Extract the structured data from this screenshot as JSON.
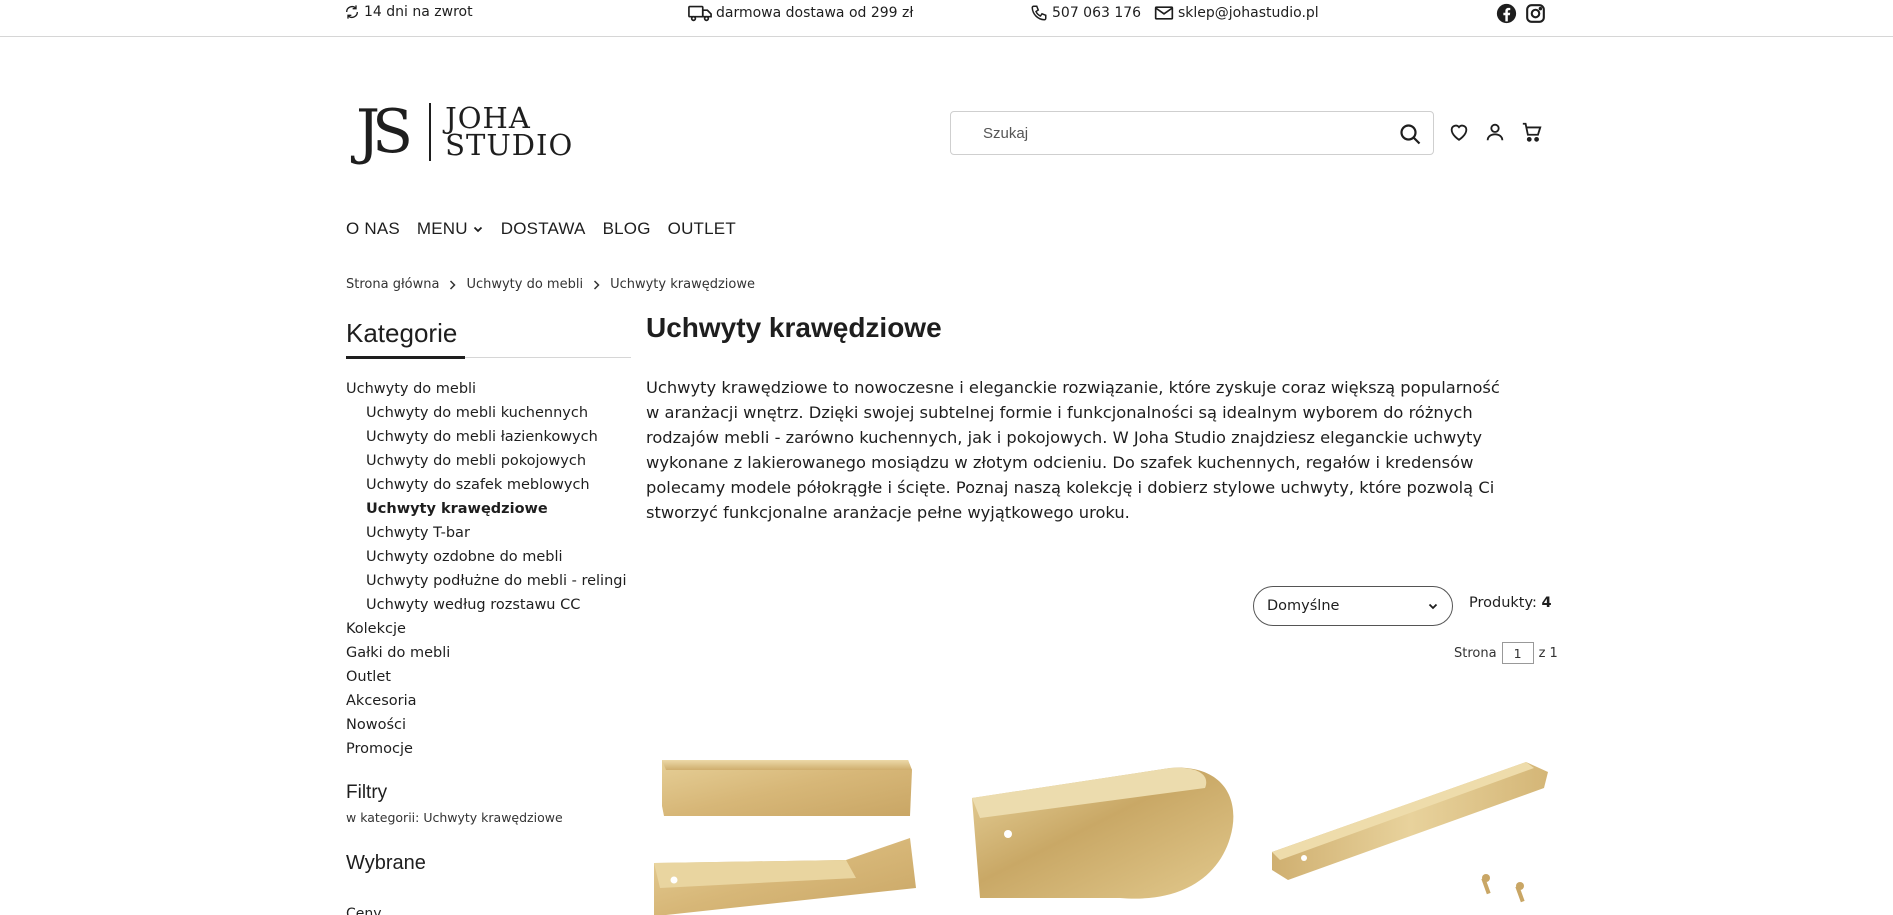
{
  "topbar": {
    "returns": "14 dni na zwrot",
    "shipping": "darmowa dostawa od 299 zł",
    "phone": "507 063 176",
    "email": "sklep@johastudio.pl",
    "social_icons": [
      "facebook-icon",
      "instagram-icon"
    ]
  },
  "logo": {
    "mark": "JS",
    "name_line1": "JOHA",
    "name_line2": "STUDIO"
  },
  "search": {
    "placeholder": "Szukaj",
    "value": ""
  },
  "header_icons": [
    "heart-icon",
    "user-icon",
    "cart-icon"
  ],
  "nav": {
    "items": [
      {
        "label": "O NAS"
      },
      {
        "label": "MENU"
      },
      {
        "label": "DOSTAWA"
      },
      {
        "label": "BLOG"
      },
      {
        "label": "OUTLET"
      }
    ]
  },
  "breadcrumb": [
    "Strona główna",
    "Uchwyty do mebli",
    "Uchwyty krawędziowe"
  ],
  "sidebar": {
    "title": "Kategorie",
    "categories": [
      {
        "label": "Uchwyty do mebli",
        "level": 0
      },
      {
        "label": "Uchwyty do mebli kuchennych",
        "level": 1
      },
      {
        "label": "Uchwyty do mebli łazienkowych",
        "level": 1
      },
      {
        "label": "Uchwyty do mebli pokojowych",
        "level": 1
      },
      {
        "label": "Uchwyty do szafek meblowych",
        "level": 1
      },
      {
        "label": "Uchwyty krawędziowe",
        "level": 1,
        "active": true
      },
      {
        "label": "Uchwyty T-bar",
        "level": 1
      },
      {
        "label": "Uchwyty ozdobne do mebli",
        "level": 1
      },
      {
        "label": "Uchwyty podłużne do mebli - relingi",
        "level": 1
      },
      {
        "label": "Uchwyty według rozstawu CC",
        "level": 1
      },
      {
        "label": "Kolekcje",
        "level": 0
      },
      {
        "label": "Gałki do mebli",
        "level": 0
      },
      {
        "label": "Outlet",
        "level": 0
      },
      {
        "label": "Akcesoria",
        "level": 0
      },
      {
        "label": "Nowości",
        "level": 0
      },
      {
        "label": "Promocje",
        "level": 0
      }
    ],
    "filters_title": "Filtry",
    "filters_subtitle": "w kategorii: Uchwyty krawędziowe",
    "selected_title": "Wybrane",
    "cut_text": "Ceny"
  },
  "main": {
    "title": "Uchwyty krawędziowe",
    "description": "Uchwyty krawędziowe to nowoczesne i eleganckie rozwiązanie, które zyskuje coraz większą popularność w aranżacji wnętrz. Dzięki swojej subtelnej formie i funkcjonalności są idealnym wyborem do różnych rodzajów mebli - zarówno kuchennych, jak i pokojowych. W Joha Studio znajdziesz eleganckie uchwyty wykonane z lakierowanego mosiądzu w złotym odcieniu. Do szafek kuchennych, regałów i kredensów polecamy modele półokrągłe i ścięte. Poznaj naszą kolekcję i dobierz stylowe uchwyty, które pozwolą Ci stworzyć funkcjonalne aranżacje pełne wyjątkowego uroku.",
    "sort_selected": "Domyślne",
    "count_label": "Produkty:",
    "count_value": "4",
    "page_label": "Strona",
    "page_value": "1",
    "page_of": "z 1"
  },
  "colors": {
    "text": "#1e1e1e",
    "border": "#d6d6d6",
    "brass": "#d9b873"
  }
}
